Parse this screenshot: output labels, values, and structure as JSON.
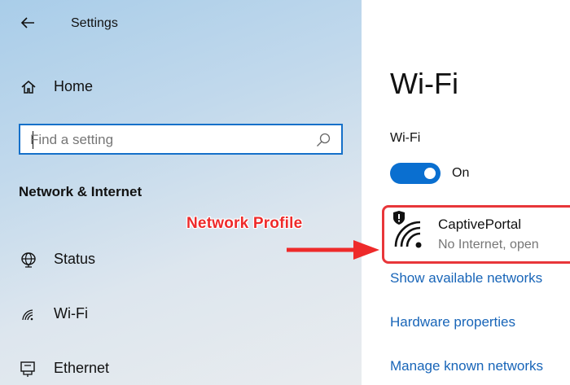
{
  "window": {
    "title": "Settings"
  },
  "sidebar": {
    "home_label": "Home",
    "search_placeholder": "Find a setting",
    "section_header": "Network & Internet",
    "items": [
      {
        "label": "Status",
        "icon": "globe-icon"
      },
      {
        "label": "Wi-Fi",
        "icon": "wifi-icon"
      },
      {
        "label": "Ethernet",
        "icon": "ethernet-icon"
      }
    ]
  },
  "annotation": {
    "label": "Network Profile",
    "color": "#ee2a2a"
  },
  "main": {
    "title": "Wi-Fi",
    "wifi_toggle": {
      "label": "Wi-Fi",
      "state": "On",
      "accent": "#0a6fd0"
    },
    "network": {
      "name": "CaptivePortal",
      "status": "No Internet, open",
      "icon": "wifi-shield-icon"
    },
    "links": [
      "Show available networks",
      "Hardware properties",
      "Manage known networks"
    ]
  }
}
